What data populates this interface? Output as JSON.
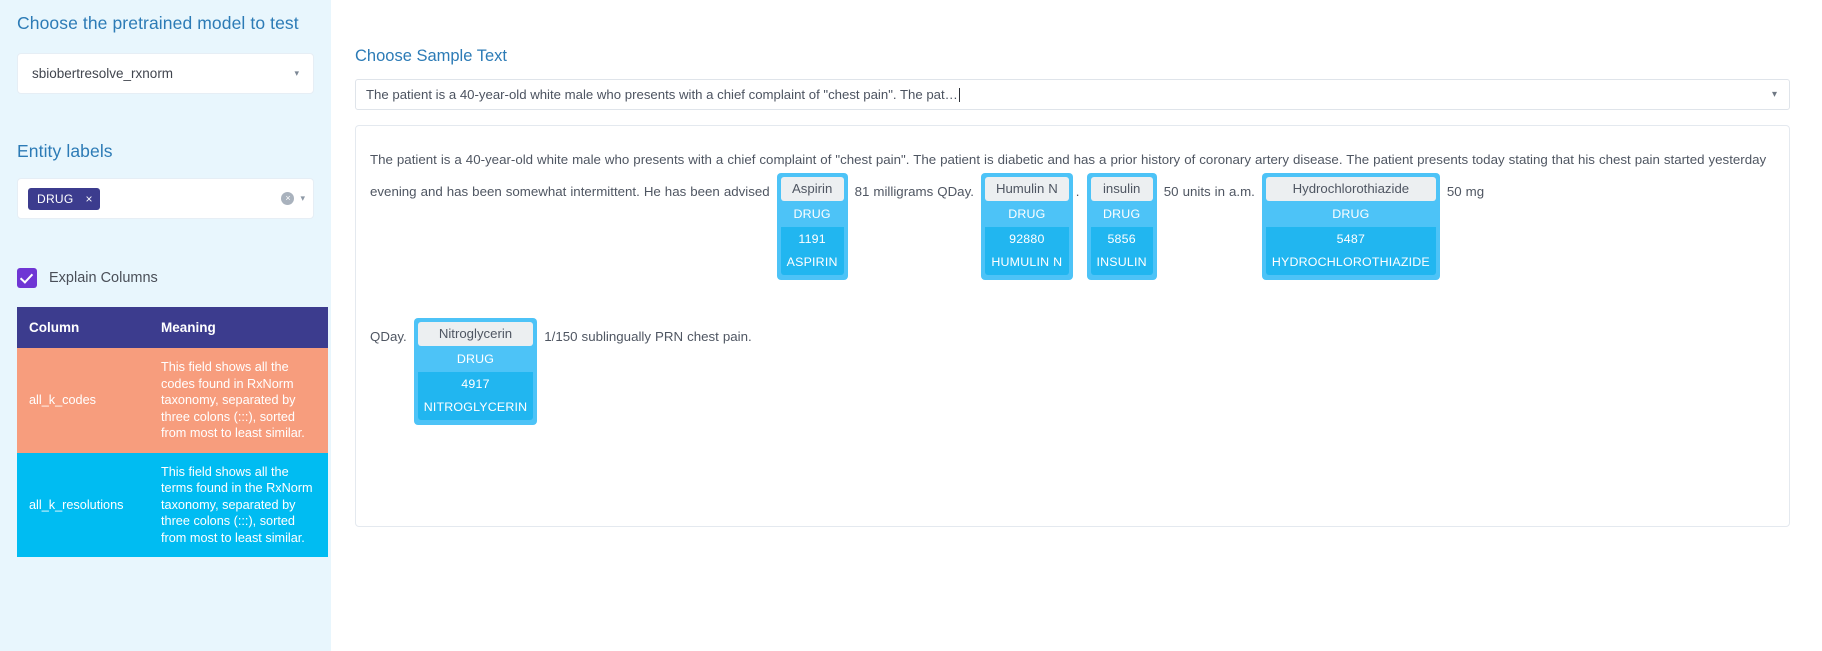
{
  "sidebar": {
    "model_heading": "Choose the pretrained model to test",
    "model_value": "sbiobertresolve_rxnorm",
    "entity_heading": "Entity labels",
    "entity_tag": "DRUG",
    "tag_remove_icon": "×",
    "clear_icon": "×",
    "caret_icon": "▾",
    "explain_checkbox_label": "Explain Columns",
    "table": {
      "headers": [
        "Column",
        "Meaning"
      ],
      "rows": [
        {
          "column": "all_k_codes",
          "meaning": "This field shows all the codes found in RxNorm taxonomy, separated by three colons (:::), sorted from most to least similar."
        },
        {
          "column": "all_k_resolutions",
          "meaning": "This field shows all the terms found in the RxNorm taxonomy, separated by three colons (:::), sorted from most to least similar."
        }
      ]
    }
  },
  "main": {
    "sample_heading": "Choose Sample Text",
    "sample_value": "The patient is a 40-year-old white male who presents with a chief complaint of \"chest pain\". The pat…",
    "caret_icon": "▾",
    "text_segments": [
      {
        "type": "text",
        "value": "The patient is a 40-year-old white male who presents with a chief complaint of \"chest pain\". The patient is diabetic and has a prior history of coronary artery disease. The patient presents today stating that his chest pain started yesterday evening and has been somewhat intermittent. He has been advised "
      },
      {
        "type": "entity",
        "surface": "Aspirin",
        "label": "DRUG",
        "code": "1191",
        "resolution": "ASPIRIN"
      },
      {
        "type": "text",
        "value": " 81 milligrams QDay. "
      },
      {
        "type": "entity",
        "surface": "Humulin N",
        "label": "DRUG",
        "code": "92880",
        "resolution": "HUMULIN N"
      },
      {
        "type": "text",
        "value": ". "
      },
      {
        "type": "entity",
        "surface": "insulin",
        "label": "DRUG",
        "code": "5856",
        "resolution": "INSULIN"
      },
      {
        "type": "text",
        "value": " 50 units in a.m. "
      },
      {
        "type": "entity",
        "surface": "Hydrochlorothiazide",
        "label": "DRUG",
        "code": "5487",
        "resolution": "HYDROCHLOROTHIAZIDE"
      },
      {
        "type": "text",
        "value": " 50 mg "
      },
      {
        "type": "linebreak"
      },
      {
        "type": "text",
        "value": "QDay. "
      },
      {
        "type": "entity",
        "surface": "Nitroglycerin",
        "label": "DRUG",
        "code": "4917",
        "resolution": "NITROGLYCERIN"
      },
      {
        "type": "text",
        "value": " 1/150 sublingually PRN chest pain."
      }
    ]
  },
  "colors": {
    "sidebar_bg": "#e8f6fd",
    "heading_blue": "#2c7bb6",
    "tag_purple": "#3c3c8e",
    "checkbox_purple": "#6f36d4",
    "row_orange": "#f79d7d",
    "row_cyan": "#00bcf2",
    "chip_light": "#4dc3f7",
    "chip_dark": "#21b6f0"
  }
}
